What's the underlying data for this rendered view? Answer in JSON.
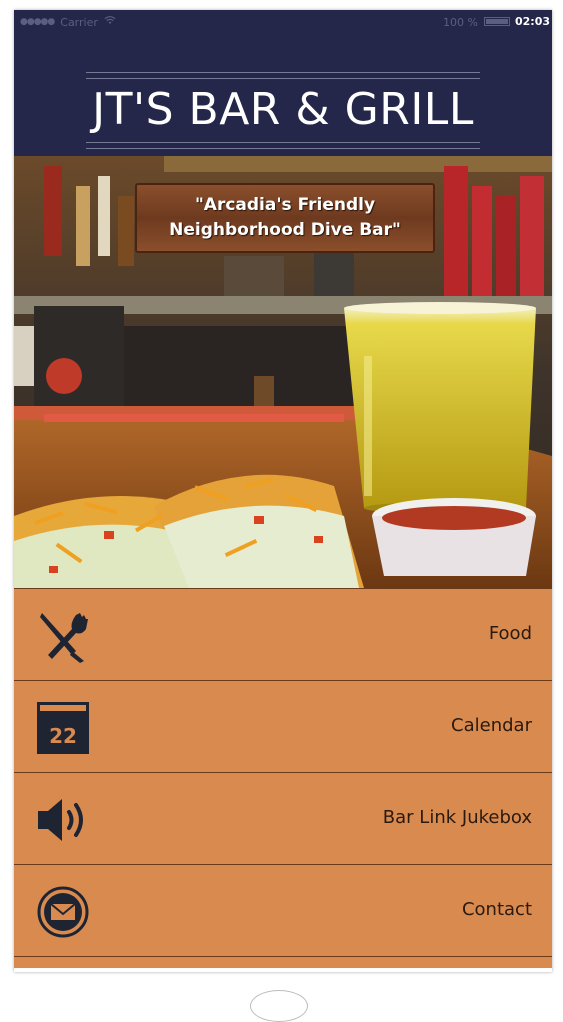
{
  "status_bar": {
    "signal": "●●●●●",
    "carrier": "Carrier",
    "battery_percent": "100 %",
    "time": "02:03"
  },
  "header": {
    "title": "JT'S BAR & GRILL"
  },
  "hero": {
    "tagline_line1": "\"Arcadia's Friendly",
    "tagline_line2": "Neighborhood Dive Bar\""
  },
  "menu": {
    "items": [
      {
        "label": "Food",
        "icon": "fork-knife-icon"
      },
      {
        "label": "Calendar",
        "icon": "calendar-icon",
        "icon_text": "22"
      },
      {
        "label": "Bar Link Jukebox",
        "icon": "speaker-icon"
      },
      {
        "label": "Contact",
        "icon": "envelope-icon"
      }
    ]
  },
  "colors": {
    "header_bg": "#24274a",
    "menu_bg": "#d98a4f",
    "menu_divider": "#6b3a18",
    "icon_color": "#1f2433"
  }
}
